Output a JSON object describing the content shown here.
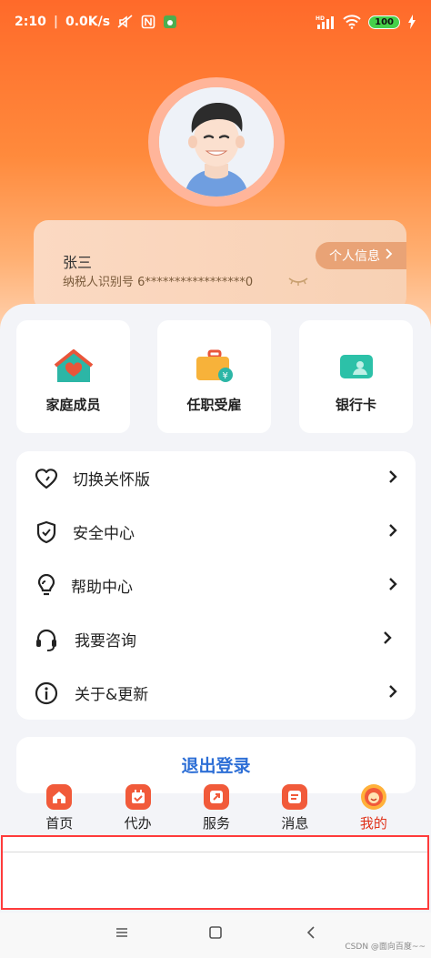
{
  "status_bar": {
    "time": "2:10",
    "speed": "0.0K/s",
    "battery": "100",
    "network": "HD"
  },
  "user": {
    "name": "张三",
    "tax_id": "纳税人识别号 6*****************0",
    "personal_info_label": "个人信息"
  },
  "quick_actions": [
    {
      "label": "家庭成员",
      "icon": "family-house-icon"
    },
    {
      "label": "任职受雇",
      "icon": "briefcase-icon"
    },
    {
      "label": "银行卡",
      "icon": "bank-card-icon"
    }
  ],
  "menu": [
    {
      "label": "切换关怀版",
      "icon": "heart-icon"
    },
    {
      "label": "安全中心",
      "icon": "shield-icon"
    },
    {
      "label": "帮助中心",
      "icon": "lightbulb-icon"
    },
    {
      "label": "我要咨询",
      "icon": "headset-icon"
    },
    {
      "label": "关于&更新",
      "icon": "info-icon"
    }
  ],
  "logout_label": "退出登录",
  "tabs": [
    {
      "label": "首页",
      "icon": "home-icon",
      "active": false
    },
    {
      "label": "代办",
      "icon": "calendar-icon",
      "active": false
    },
    {
      "label": "服务",
      "icon": "service-icon",
      "active": false
    },
    {
      "label": "消息",
      "icon": "message-icon",
      "active": false
    },
    {
      "label": "我的",
      "icon": "profile-icon",
      "active": true
    }
  ],
  "watermark": "CSDN @面向百度~~",
  "colors": {
    "accent": "#ff6a2a",
    "active_tab": "#e0321a",
    "logout": "#2e6fd6",
    "highlight": "#ff3b3b"
  }
}
